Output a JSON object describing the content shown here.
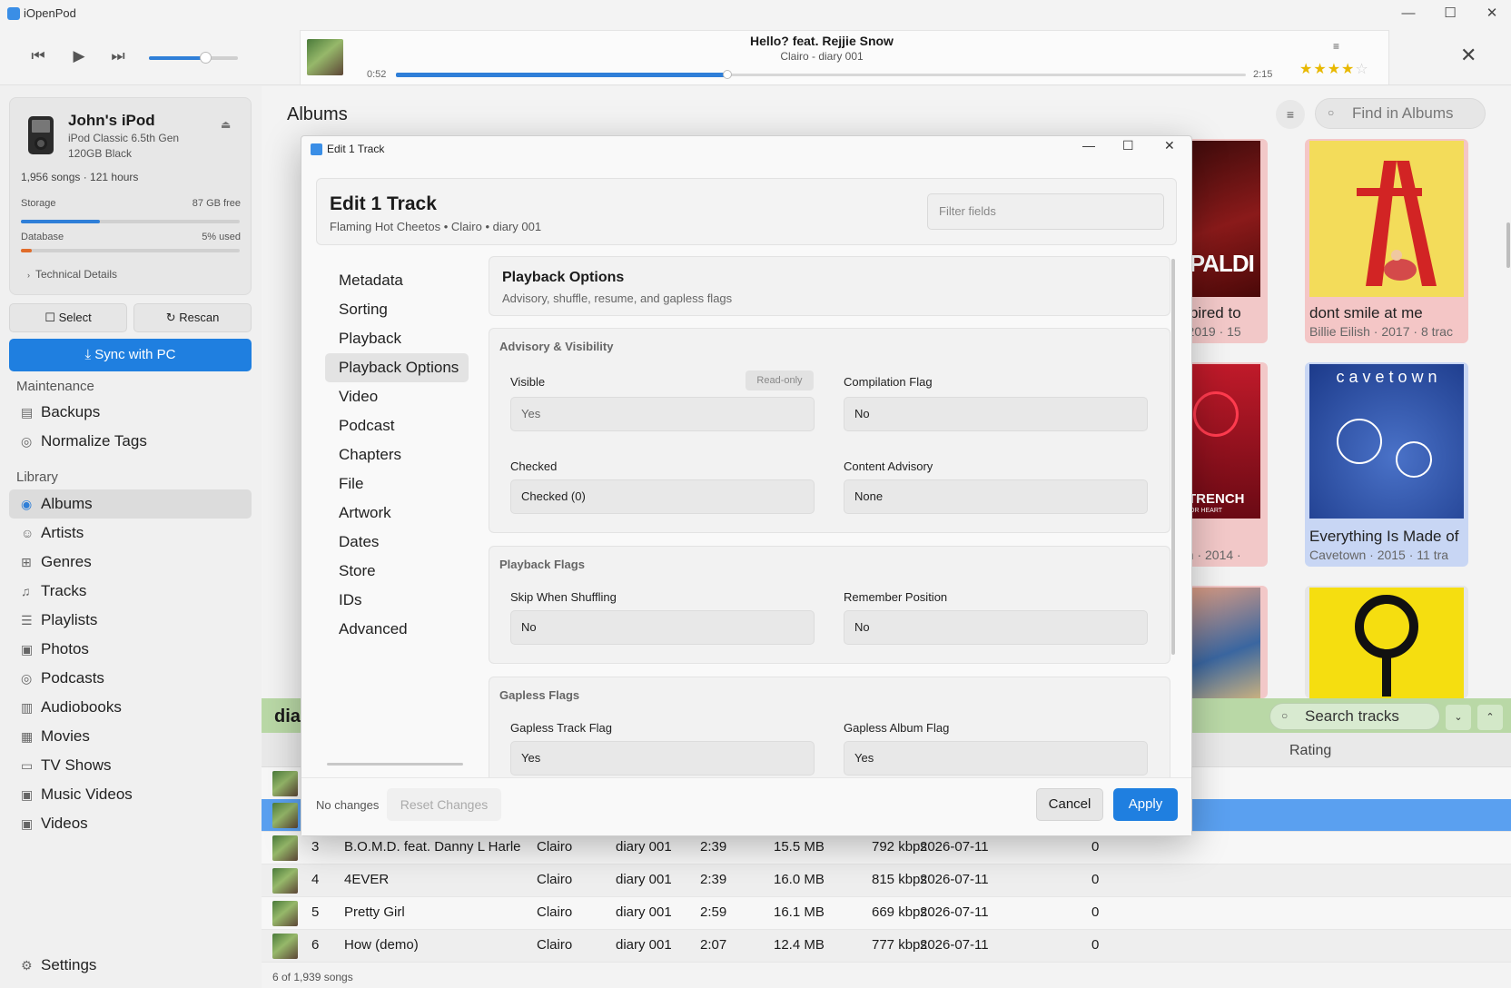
{
  "app": {
    "title": "iOpenPod"
  },
  "now_playing": {
    "title": "Hello? feat. Rejjie Snow",
    "subtitle": "Clairo - diary 001",
    "elapsed": "0:52",
    "total": "2:15",
    "progress": 0.39,
    "volume": 0.63,
    "rating": 4,
    "rating_max": 5
  },
  "device": {
    "name": "John's iPod",
    "model": "iPod Classic 6.5th Gen",
    "capacity": "120GB Black",
    "stats": "1,956 songs · 121 hours",
    "storage_label": "Storage",
    "storage_free": "87 GB free",
    "storage_used_fraction": 0.36,
    "database_label": "Database",
    "database_used": "5% used",
    "database_used_fraction": 0.05,
    "tech_details": "Technical Details"
  },
  "sidebar": {
    "select_label": "Select",
    "rescan_label": "Rescan",
    "sync_label": "Sync with PC",
    "maintenance_header": "Maintenance",
    "maintenance": [
      {
        "label": "Backups",
        "icon": "archive-icon"
      },
      {
        "label": "Normalize Tags",
        "icon": "check-circle-icon"
      }
    ],
    "library_header": "Library",
    "library": [
      {
        "label": "Albums",
        "icon": "album-icon"
      },
      {
        "label": "Artists",
        "icon": "person-icon"
      },
      {
        "label": "Genres",
        "icon": "grid-icon"
      },
      {
        "label": "Tracks",
        "icon": "music-note-icon"
      },
      {
        "label": "Playlists",
        "icon": "playlist-icon"
      },
      {
        "label": "Photos",
        "icon": "photo-icon"
      },
      {
        "label": "Podcasts",
        "icon": "podcast-icon"
      },
      {
        "label": "Audiobooks",
        "icon": "book-icon"
      },
      {
        "label": "Movies",
        "icon": "film-icon"
      },
      {
        "label": "TV Shows",
        "icon": "tv-icon"
      },
      {
        "label": "Music Videos",
        "icon": "video-icon"
      },
      {
        "label": "Videos",
        "icon": "video-icon"
      }
    ],
    "settings_label": "Settings"
  },
  "albums": {
    "header": "Albums",
    "search_placeholder": "Find in Albums",
    "cards": [
      {
        "title": "nspired to",
        "subtitle": "i · 2019 · 15",
        "cover_text": "APALDI"
      },
      {
        "title": "dont smile at me",
        "subtitle": "Billie Eilish · 2017 · 8 trac"
      },
      {
        "title": "",
        "subtitle": "nch · 2014 ·",
        "cover_text": "TRENCH",
        "cover_small": "OR HEART"
      },
      {
        "title": "Everything Is Made of",
        "subtitle": "Cavetown · 2015 · 11 tra",
        "cover_text": "c a v e t o w n"
      }
    ]
  },
  "tracks": {
    "header": "dia",
    "search_placeholder": "Search tracks",
    "rating_header": "Rating",
    "rows": [
      {
        "num": "3",
        "title": "B.O.M.D. feat. Danny L Harle",
        "artist": "Clairo",
        "album": "diary 001",
        "time": "2:39",
        "size": "15.5 MB",
        "bitrate": "792 kbps",
        "date": "2026-07-11",
        "plays": "0"
      },
      {
        "num": "4",
        "title": "4EVER",
        "artist": "Clairo",
        "album": "diary 001",
        "time": "2:39",
        "size": "16.0 MB",
        "bitrate": "815 kbps",
        "date": "2026-07-11",
        "plays": "0"
      },
      {
        "num": "5",
        "title": "Pretty Girl",
        "artist": "Clairo",
        "album": "diary 001",
        "time": "2:59",
        "size": "16.1 MB",
        "bitrate": "669 kbps",
        "date": "2026-07-11",
        "plays": "0"
      },
      {
        "num": "6",
        "title": "How (demo)",
        "artist": "Clairo",
        "album": "diary 001",
        "time": "2:07",
        "size": "12.4 MB",
        "bitrate": "777 kbps",
        "date": "2026-07-11",
        "plays": "0"
      }
    ],
    "footer": "6 of 1,939 songs"
  },
  "dialog": {
    "window_title": "Edit 1 Track",
    "title": "Edit 1 Track",
    "subtitle": "Flaming Hot Cheetos • Clairo • diary 001",
    "filter_placeholder": "Filter fields",
    "nav": [
      "Metadata",
      "Sorting",
      "Playback",
      "Playback Options",
      "Video",
      "Podcast",
      "Chapters",
      "File",
      "Artwork",
      "Dates",
      "Store",
      "IDs",
      "Advanced"
    ],
    "active_nav": "Playback Options",
    "section_title": "Playback Options",
    "section_subtitle": "Advisory, shuffle, resume, and gapless flags",
    "groups": {
      "advisory": {
        "title": "Advisory & Visibility",
        "visible_label": "Visible",
        "visible_value": "Yes",
        "readonly_badge": "Read-only",
        "compilation_label": "Compilation Flag",
        "compilation_value": "No",
        "checked_label": "Checked",
        "checked_value": "Checked (0)",
        "advisory_label": "Content Advisory",
        "advisory_value": "None"
      },
      "playback": {
        "title": "Playback Flags",
        "skip_label": "Skip When Shuffling",
        "skip_value": "No",
        "remember_label": "Remember Position",
        "remember_value": "No"
      },
      "gapless": {
        "title": "Gapless Flags",
        "track_label": "Gapless Track Flag",
        "track_value": "Yes",
        "album_label": "Gapless Album Flag",
        "album_value": "Yes"
      }
    },
    "footer_status": "No changes",
    "reset_label": "Reset Changes",
    "cancel_label": "Cancel",
    "apply_label": "Apply"
  }
}
